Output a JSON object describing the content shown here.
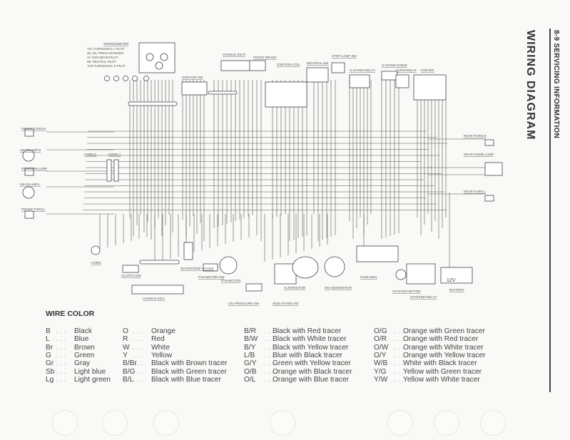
{
  "header": {
    "section": "8-9  SERVICING INFORMATION",
    "title": "WIRING DIAGRAM"
  },
  "diagram": {
    "speedometer": {
      "title": "SPEEDOMETER",
      "legend": [
        "TUL:TURNSIGNAL L PILOT",
        "OIL:OIL PRESS WARNING",
        "HI :HIGH BEAM PILOT",
        "NE :NEUTRAL PILOT",
        "TUR:TURNSIGNAL R PILOT"
      ]
    },
    "components": [
      "IGNITION-SW",
      "HANDLE-SW.R",
      "FRONT BRAKE",
      "IGNITION-COIL",
      "NEUTRAL-SW",
      "STOP LAMP SW",
      "S-STAND-RELAY",
      "S-STAND DIODE",
      "TURN-RELAY",
      "IGNITER",
      "FRONT-TURN.R",
      "HEADLAMP.R",
      "POSITION-LAMP",
      "HEADLAMP.L",
      "FRONT-TURN.L",
      "HORN.2",
      "HORN.1",
      "REAR-TURN.R",
      "REAR-COMB-LAMP",
      "REAR-TURN.L",
      "HORN",
      "CLUTCH-SW",
      "HANDLE-SW.L",
      "WATERTEMP GAUGE",
      "FAN-MOTOR-SW",
      "FAN-MOTOR",
      "OIL-PRESSURE-SW",
      "SIDE-STAND-SW",
      "ALTERNATOR",
      "SIG-GENERATOR",
      "FUSE-BOX",
      "STARTER-MOTOR",
      "STARTER-RELAY",
      "BATTERY"
    ],
    "battery_voltage": "12V"
  },
  "wire_color": {
    "title": "WIRE COLOR",
    "columns": [
      [
        [
          "B",
          "Black"
        ],
        [
          "L",
          "Blue"
        ],
        [
          "Br",
          "Brown"
        ],
        [
          "G",
          "Green"
        ],
        [
          "Gr",
          "Gray"
        ],
        [
          "Sb",
          "Light blue"
        ],
        [
          "Lg",
          "Light green"
        ]
      ],
      [
        [
          "O",
          "Orange"
        ],
        [
          "R",
          "Red"
        ],
        [
          "W",
          "White"
        ],
        [
          "Y",
          "Yellow"
        ],
        [
          "B/Br",
          "Black with Brown tracer"
        ],
        [
          "B/G",
          "Black with Green tracer"
        ],
        [
          "B/L",
          "Black with Blue tracer"
        ]
      ],
      [
        [
          "B/R",
          "Black with Red tracer"
        ],
        [
          "B/W",
          "Black with White tracer"
        ],
        [
          "B/Y",
          "Black with Yellow tracer"
        ],
        [
          "L/B",
          "Blue with Black tracer"
        ],
        [
          "G/Y",
          "Green with Yellow tracer"
        ],
        [
          "O/B",
          "Orange with Black tracer"
        ],
        [
          "O/L",
          "Orange with Blue tracer"
        ]
      ],
      [
        [
          "O/G",
          "Orange with Green tracer"
        ],
        [
          "O/R",
          "Orange with Red tracer"
        ],
        [
          "O/W",
          "Orange with White tracer"
        ],
        [
          "O/Y",
          "Orange with Yellow tracer"
        ],
        [
          "W/B",
          "White with Black tracer"
        ],
        [
          "Y/G",
          "Yellow with Green tracer"
        ],
        [
          "Y/W",
          "Yellow with White tracer"
        ]
      ]
    ]
  },
  "colors": {
    "ink": "#444444",
    "paper": "#f9f9f7"
  }
}
